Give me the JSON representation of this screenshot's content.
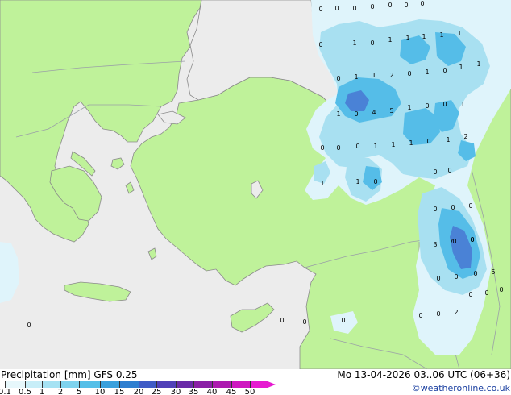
{
  "legend": {
    "title": "Precipitation [mm]",
    "model": "GFS 0.25",
    "ticks": [
      "0.1",
      "0.5",
      "1",
      "2",
      "5",
      "10",
      "15",
      "20",
      "25",
      "30",
      "35",
      "40",
      "45",
      "50"
    ],
    "colors": [
      "#e6f7fb",
      "#c8eef8",
      "#a5e2f3",
      "#7fd3ee",
      "#55bfe8",
      "#3aa0dc",
      "#2f7fd0",
      "#3f5cc6",
      "#5040b8",
      "#6a2aa8",
      "#8b1fa6",
      "#ad1ab0",
      "#cf17c0",
      "#e61ad0"
    ]
  },
  "timestamp": "Mo 13-04-2026 03..06 UTC (06+36)",
  "credit": "©weatheronline.co.uk",
  "map_colors": {
    "sea": "#ececec",
    "land": "#bff29a",
    "coast": "#8a8a8a",
    "border": "#9aa0a6",
    "precip_light": "#dff4fb",
    "precip_mid": "#a8e0f1",
    "precip_heavy": "#55bde8",
    "precip_max": "#4a82d6"
  },
  "value_labels": [
    "0",
    "0",
    "0",
    "0",
    "0",
    "0",
    "0",
    "0",
    "1",
    "0",
    "1",
    "1",
    "1",
    "1",
    "1",
    "0",
    "1",
    "1",
    "2",
    "0",
    "1",
    "0",
    "1",
    "1",
    "1",
    "0",
    "4",
    "5",
    "1",
    "0",
    "0",
    "1",
    "0",
    "0",
    "0",
    "1",
    "1",
    "1",
    "0",
    "1",
    "2",
    "1",
    "1",
    "0",
    "0",
    "0",
    "0",
    "0",
    "0",
    "3",
    "0",
    "0",
    "0",
    "0",
    "0",
    "5",
    "7",
    "0",
    "0",
    "0",
    "2",
    "0",
    "0",
    "0",
    "0",
    "0",
    "0",
    "0"
  ]
}
